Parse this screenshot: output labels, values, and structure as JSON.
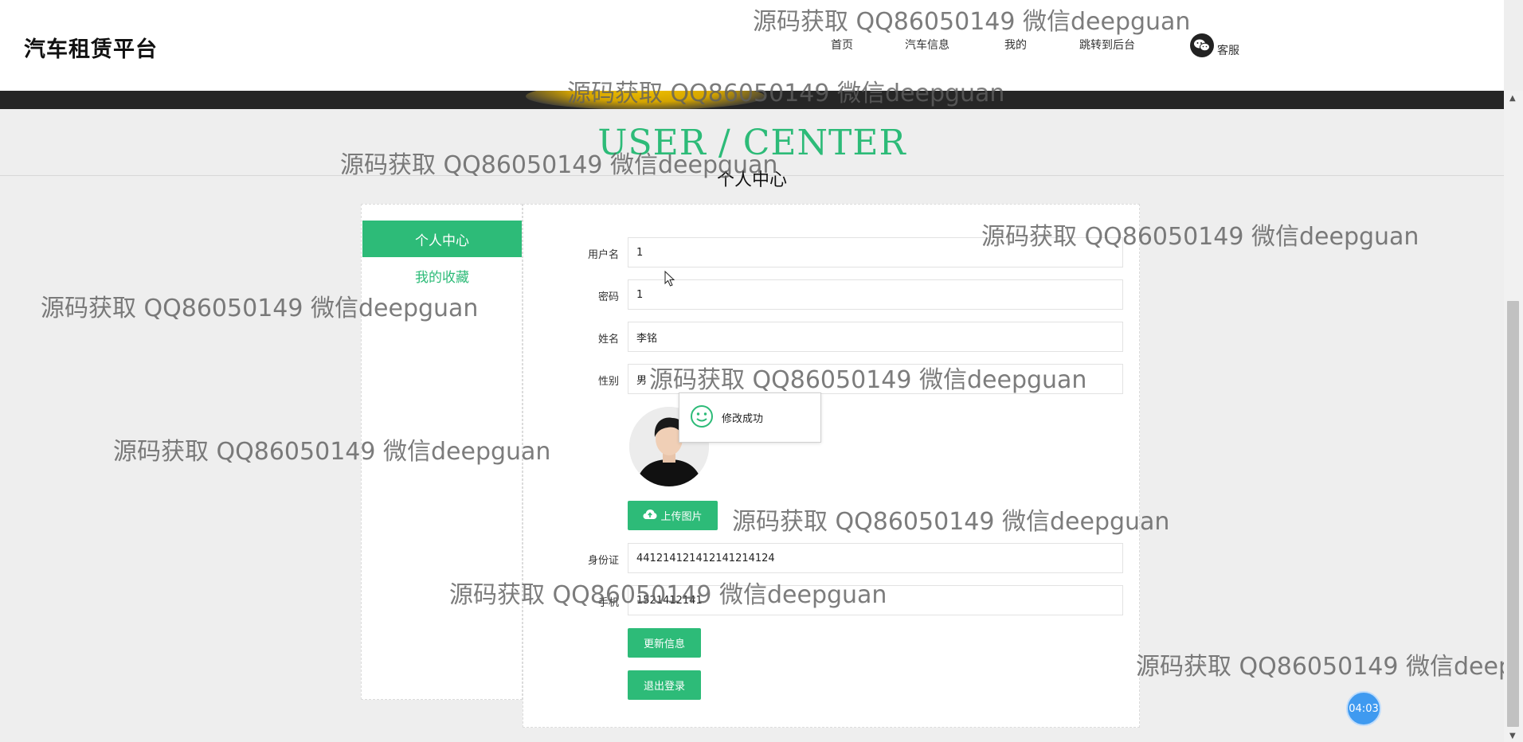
{
  "header": {
    "brand": "汽车租赁平台",
    "nav": [
      "首页",
      "汽车信息",
      "我的",
      "跳转到后台"
    ],
    "service_label": "客服"
  },
  "page": {
    "title_en": "USER / CENTER",
    "title_cn": "个人中心"
  },
  "sidebar": {
    "items": [
      "个人中心",
      "我的收藏"
    ],
    "active_index": 0
  },
  "form": {
    "fields": [
      {
        "label": "用户名",
        "value": "1"
      },
      {
        "label": "密码",
        "value": "1"
      },
      {
        "label": "姓名",
        "value": "李铭"
      },
      {
        "label": "性别",
        "value": "男"
      },
      {
        "label": "身份证",
        "value": "441214121412141214124"
      },
      {
        "label": "手机",
        "value": "1521412141"
      }
    ],
    "upload_label": "上传图片",
    "update_label": "更新信息",
    "logout_label": "退出登录"
  },
  "toast": {
    "message": "修改成功",
    "icon": "smile-icon"
  },
  "timer": "04:03",
  "watermark": "源码获取 QQ86050149 微信deepguan",
  "colors": {
    "accent": "#2dbb78",
    "background": "#eeeeee",
    "timer": "#3f9af0"
  }
}
